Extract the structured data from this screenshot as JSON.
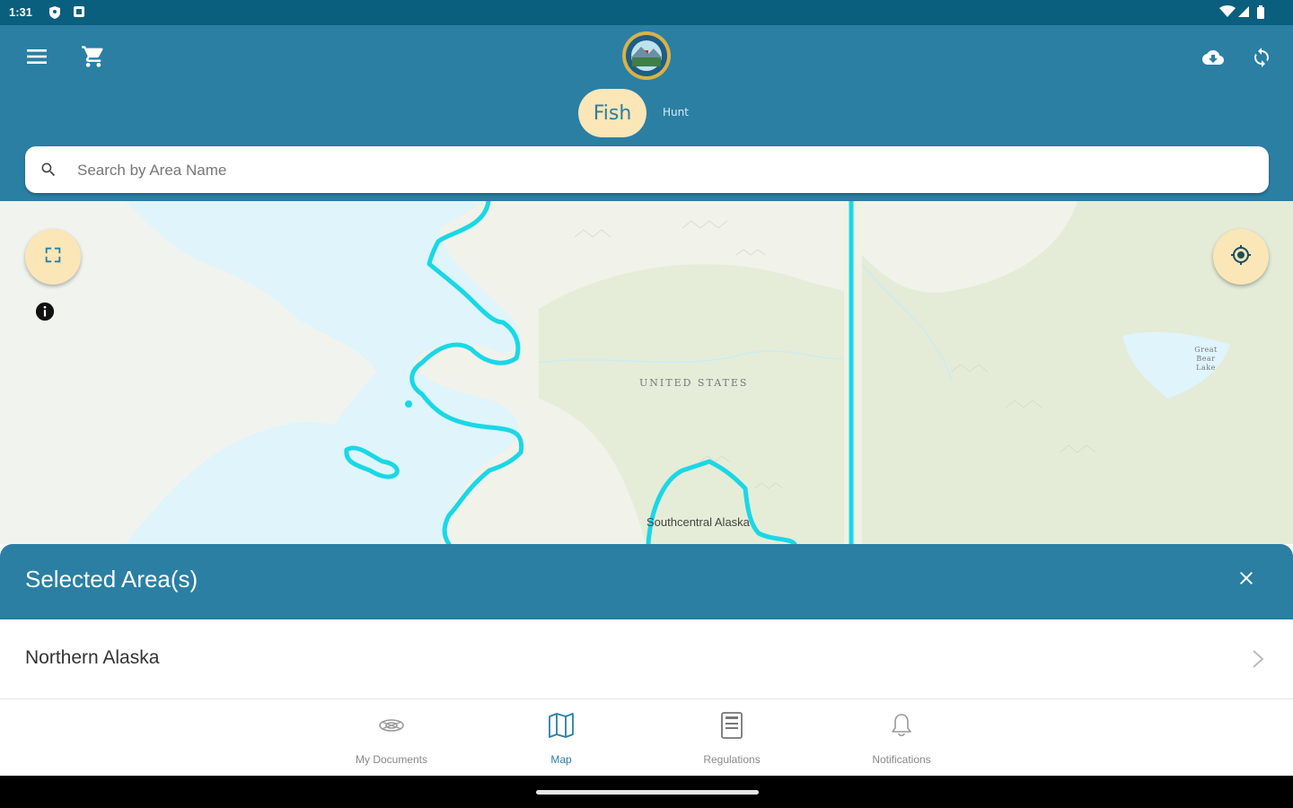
{
  "status_bar": {
    "time": "1:31"
  },
  "app_bar": {
    "menu_icon": "menu-icon",
    "cart_icon": "cart-icon",
    "logo_icon": "state-seal-logo",
    "download_icon": "cloud-download-icon",
    "sync_icon": "sync-icon",
    "tabs": [
      {
        "label": "Fish",
        "selected": true
      },
      {
        "label": "Hunt",
        "selected": false
      }
    ]
  },
  "search": {
    "placeholder": "Search by Area Name",
    "value": ""
  },
  "map": {
    "labels": {
      "country": "UNITED STATES",
      "lake": "Great Bear Lake",
      "region": "Southcentral Alaska"
    },
    "controls": {
      "expand_icon": "fullscreen-icon",
      "locate_icon": "my-location-icon",
      "info_icon": "info-icon"
    }
  },
  "sheet": {
    "title": "Selected Area(s)",
    "close_icon": "close-icon",
    "items": [
      {
        "label": "Northern Alaska"
      }
    ]
  },
  "bottom_nav": {
    "items": [
      {
        "label": "My Documents",
        "icon": "documents-icon",
        "active": false
      },
      {
        "label": "Map",
        "icon": "map-icon",
        "active": true
      },
      {
        "label": "Regulations",
        "icon": "regulations-icon",
        "active": false
      },
      {
        "label": "Notifications",
        "icon": "bell-icon",
        "active": false
      }
    ]
  },
  "colors": {
    "primary": "#2a7fa3",
    "accent": "#fbe6b7",
    "boundary": "#19d8e6",
    "water": "#dff4fb",
    "land": "#eef3e6"
  }
}
